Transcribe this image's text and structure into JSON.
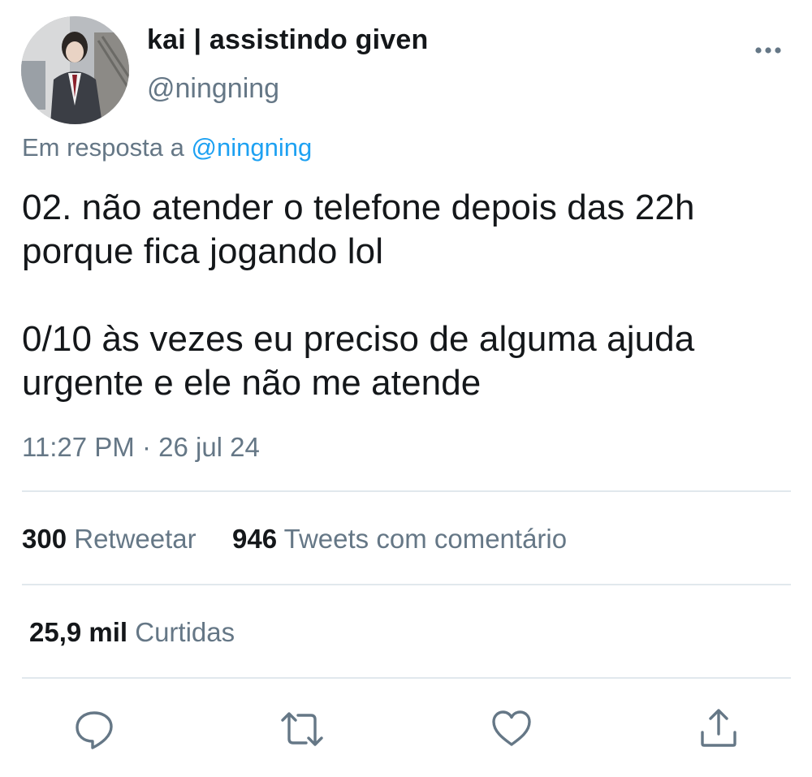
{
  "author": {
    "display_name": "kai | assistindo given",
    "handle": "@ningning",
    "avatar_icon": "avatar-photo"
  },
  "more_icon": "more-horizontal-icon",
  "reply": {
    "prefix": "Em resposta a",
    "mention": "@ningning"
  },
  "tweet": {
    "text": "02. não atender o telefone depois das 22h\nporque fica jogando lol\n\n0/10 às vezes eu preciso de alguma ajuda\nurgente e ele não me atende",
    "timestamp": "11:27 PM · 26 jul 24"
  },
  "stats": {
    "retweets_count": "300",
    "retweets_label": "Retweetar",
    "quotes_count": "946",
    "quotes_label": "Tweets com comentário",
    "likes_count": "25,9 mil",
    "likes_label": "Curtidas"
  },
  "actions": [
    {
      "icon": "reply-icon"
    },
    {
      "icon": "retweet-icon"
    },
    {
      "icon": "like-icon"
    },
    {
      "icon": "share-icon"
    }
  ],
  "colors": {
    "text_primary": "#14171a",
    "text_secondary": "#657786",
    "link": "#1da1f2",
    "divider": "#e1e8ed"
  }
}
